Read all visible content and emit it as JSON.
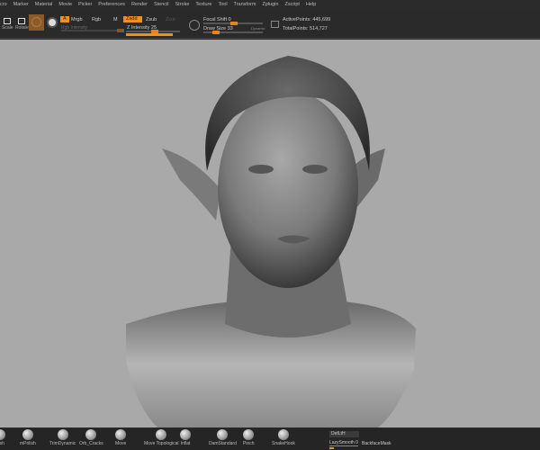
{
  "menu": [
    "cro",
    "Marker",
    "Material",
    "Movie",
    "Picker",
    "Preferences",
    "Render",
    "Stencil",
    "Stroke",
    "Texture",
    "Tool",
    "Transform",
    "Zplugin",
    "Zscript",
    "Help"
  ],
  "toolbar": {
    "scale_label": "Scale",
    "rotate_label": "Rotate",
    "a_label": "A",
    "mrgb": "Mrgb",
    "rgb": "Rgb",
    "m": "M",
    "rgb_intensity": "Rgb Intensity",
    "zadd": "Zadd",
    "zsub": "Zsub",
    "zcut": "Zcut",
    "z_intensity": "Z Intensity 25",
    "z_intensity_value": 25,
    "focal_shift": "Focal Shift 0",
    "focal_shift_value": 0,
    "draw_size": "Draw Size 33",
    "draw_size_value": 33,
    "dynamic": "Dynamic",
    "active_points": "ActivePoints: 445,699",
    "total_points": "TotalPoints: 514,727"
  },
  "brushes": [
    "rush",
    "mPolish",
    "TrimDynamic",
    "Orb_Cracks",
    "Move",
    "Move Topological",
    "Inflat",
    "DamStandard",
    "Pinch",
    "SnakeHook"
  ],
  "bottom": {
    "deformation": "DefLtH",
    "lazy_smooth": "LazySmooth 0",
    "backface_mask": "BackfaceMask"
  },
  "colors": {
    "accent": "#f0901e",
    "viewport": "#a9a9a9",
    "panel": "#2a2a2a"
  }
}
